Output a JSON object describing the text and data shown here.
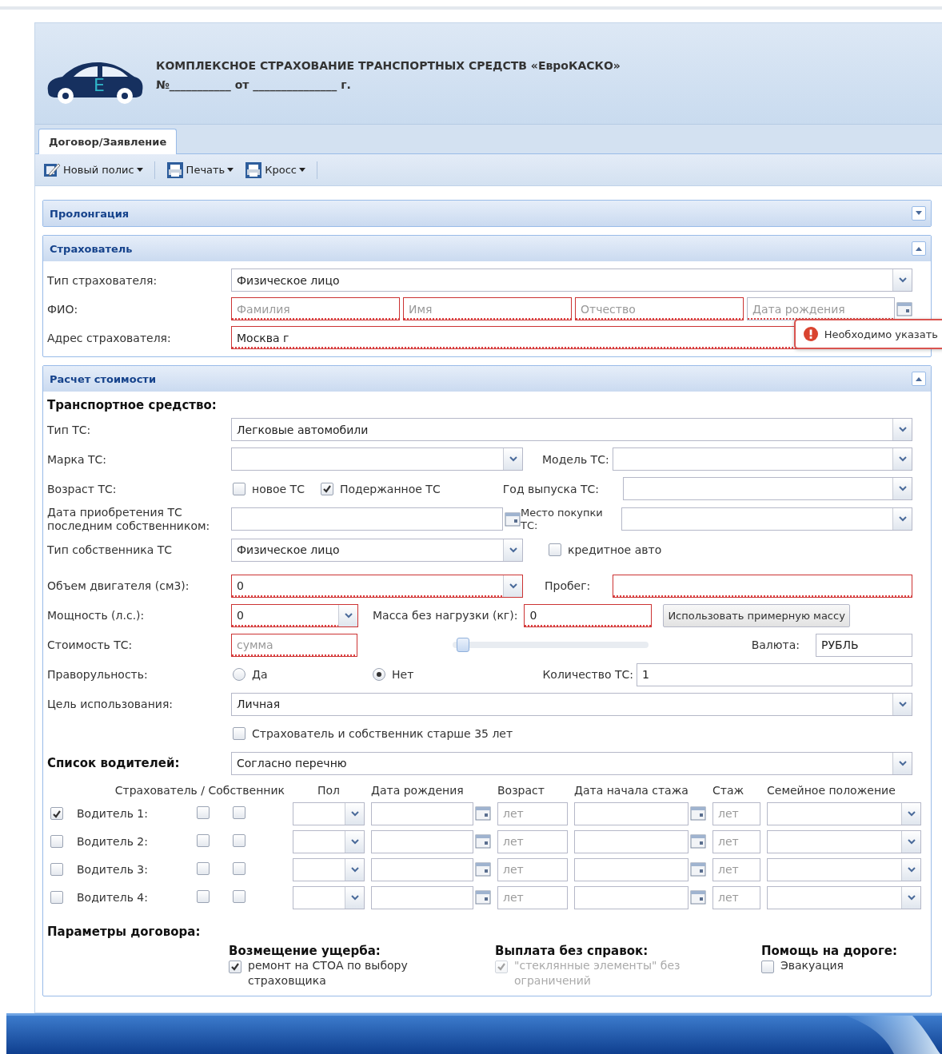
{
  "header": {
    "logo_letter": "E",
    "title": "КОМПЛЕКСНОЕ СТРАХОВАНИЕ ТРАНСПОРТНЫХ СРЕДСТВ «ЕвроКАСКО»",
    "number_line": "№___________ от _______________ г."
  },
  "tabs": [
    {
      "label": "Договор/Заявление",
      "selected": true
    }
  ],
  "toolbar": [
    {
      "label": "Новый полис"
    },
    {
      "label": "Печать"
    },
    {
      "label": "Кросс"
    }
  ],
  "prolongation": {
    "title": "Пролонгация",
    "expanded": false
  },
  "insurant": {
    "title": "Страхователь",
    "expanded": true,
    "type": {
      "label": "Тип страхователя:",
      "value": "Физическое лицо"
    },
    "fio": {
      "label": "ФИО:",
      "fields": [
        {
          "placeholder": "Фамилия",
          "invalid": true
        },
        {
          "placeholder": "Имя",
          "invalid": true
        },
        {
          "placeholder": "Отчество",
          "invalid": true
        },
        {
          "placeholder": "Дата рождения",
          "invalid": true
        }
      ]
    },
    "address": {
      "label": "Адрес страхователя:",
      "value": "Москва г",
      "invalid": true
    },
    "error_tooltip": "Необходимо указать"
  },
  "calc": {
    "title": "Расчет стоимости",
    "expanded": true,
    "vehicle_heading": "Транспортное средство:",
    "vehicle_type": {
      "label": "Тип ТС:",
      "value": "Легковые автомобили"
    },
    "make": {
      "label": "Марка ТС:"
    },
    "model": {
      "label": "Модель ТС:"
    },
    "age": {
      "label": "Возраст ТС:",
      "options": [
        {
          "label": "новое ТС",
          "checked": false
        },
        {
          "label": "Подержанное ТС",
          "checked": true
        }
      ]
    },
    "year": {
      "label": "Год выпуска ТС:"
    },
    "purchase_date": {
      "label": "Дата приобретения ТС последним собственником:"
    },
    "purchase_place": {
      "label": "Место покупки ТС:"
    },
    "owner_type": {
      "label": "Тип собственника ТС",
      "value": "Физическое лицо"
    },
    "credit": {
      "label": "кредитное авто",
      "checked": false
    },
    "engine": {
      "label": "Объем двигателя (см3):",
      "value": "0",
      "invalid": true
    },
    "mileage": {
      "label": "Пробег:",
      "invalid": true
    },
    "power": {
      "label": "Мощность (л.с.):",
      "value": "0",
      "invalid": true
    },
    "mass": {
      "label": "Масса без нагрузки (кг):",
      "value": "0",
      "invalid": true
    },
    "mass_button": "Использовать примерную массу",
    "cost": {
      "label": "Стоимость ТС:",
      "placeholder": "сумма",
      "invalid": true
    },
    "cost_slider": {
      "level": 0.02
    },
    "currency": {
      "label": "Валюта:",
      "value": "РУБЛЬ"
    },
    "right_hand": {
      "label": "Праворульность:",
      "options": [
        {
          "label": "Да",
          "selected": false
        },
        {
          "label": "Нет",
          "selected": true
        }
      ]
    },
    "count": {
      "label": "Количество ТС:",
      "value": "1"
    },
    "purpose": {
      "label": "Цель использования:",
      "value": "Личная"
    },
    "over35": {
      "label": "Страхователь и собственник старше 35 лет",
      "checked": false
    },
    "drivers": {
      "label": "Список водителей:",
      "value": "Согласно перечню",
      "columns": [
        "Страхователь / Собственник",
        "Пол",
        "Дата рождения",
        "Возраст",
        "Дата начала стажа",
        "Стаж",
        "Семейное положение"
      ],
      "rows": [
        {
          "label": "Водитель 1:",
          "checked": true,
          "insurant": false,
          "owner": false,
          "age_placeholder": "лет",
          "experience_placeholder": "лет"
        },
        {
          "label": "Водитель 2:",
          "checked": false,
          "insurant": false,
          "owner": false,
          "age_placeholder": "лет",
          "experience_placeholder": "лет"
        },
        {
          "label": "Водитель 3:",
          "checked": false,
          "insurant": false,
          "owner": false,
          "age_placeholder": "лет",
          "experience_placeholder": "лет"
        },
        {
          "label": "Водитель 4:",
          "checked": false,
          "insurant": false,
          "owner": false,
          "age_placeholder": "лет",
          "experience_placeholder": "лет"
        }
      ]
    },
    "params": {
      "heading": "Параметры договора:",
      "groups": [
        {
          "title": "Возмещение ущерба:",
          "option": {
            "label": "ремонт на СТОА по выбору страховщика",
            "checked": true,
            "disabled": false
          }
        },
        {
          "title": "Выплата без справок:",
          "option": {
            "label": "\"стеклянные элементы\" без ограничений",
            "checked": true,
            "disabled": true
          }
        },
        {
          "title": "Помощь на дороге:",
          "option": {
            "label": "Эвакуация",
            "checked": false,
            "disabled": false
          }
        }
      ]
    }
  }
}
